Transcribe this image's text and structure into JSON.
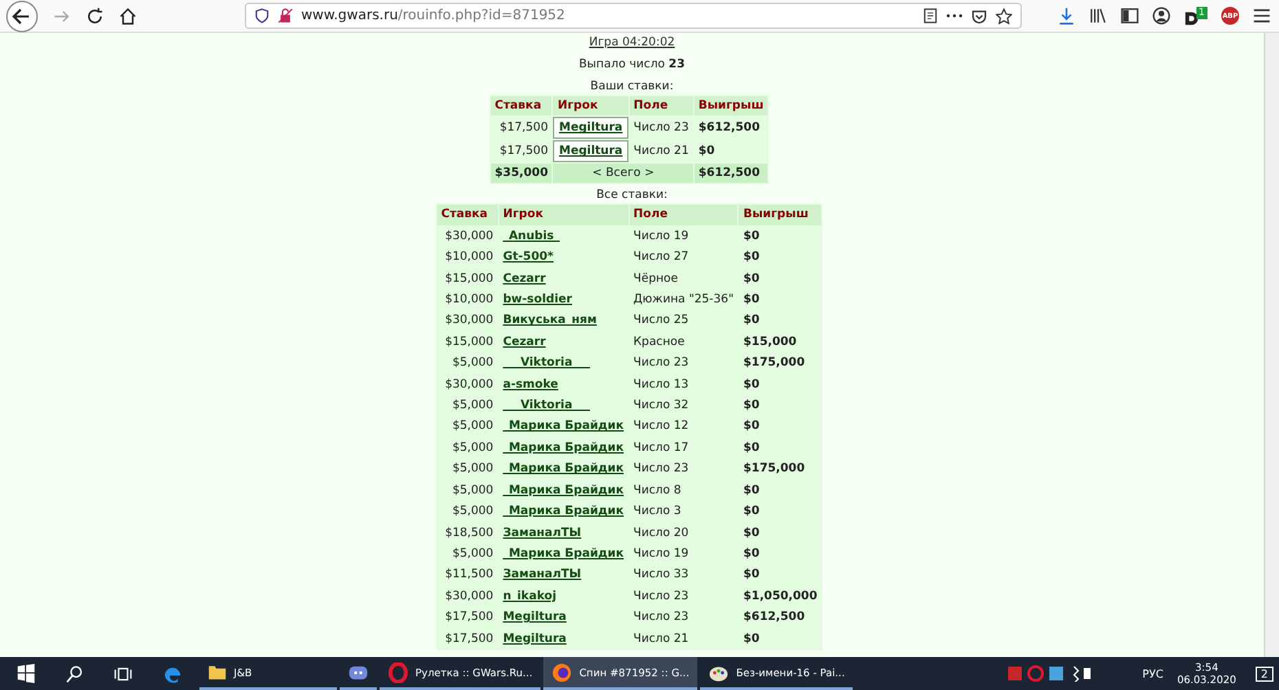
{
  "browser": {
    "url_host": "www.gwars.ru",
    "url_path": "/rouinfo.php?id=871952",
    "extension_badge": "1",
    "adblock_label": "ABP"
  },
  "game": {
    "title": "Игра 04:20:02",
    "result_label": "Выпало число",
    "result_number": "23"
  },
  "your_bets": {
    "caption": "Ваши ставки:",
    "columns": [
      "Ставка",
      "Игрок",
      "Поле",
      "Выигрыш"
    ],
    "rows": [
      {
        "stake": "$17,500",
        "player": "Megiltura",
        "field": "Число 23",
        "win": "$612,500"
      },
      {
        "stake": "$17,500",
        "player": "Megiltura",
        "field": "Число 21",
        "win": "$0"
      }
    ],
    "total": {
      "stake": "$35,000",
      "label": "< Всего >",
      "win": "$612,500"
    }
  },
  "all_bets": {
    "caption": "Все ставки:",
    "columns": [
      "Ставка",
      "Игрок",
      "Поле",
      "Выигрыш"
    ],
    "rows": [
      {
        "stake": "$30,000",
        "player": "_Anubis_",
        "field": "Число 19",
        "win": "$0"
      },
      {
        "stake": "$10,000",
        "player": "Gt-500*",
        "field": "Число 27",
        "win": "$0"
      },
      {
        "stake": "$15,000",
        "player": "Cezarr",
        "field": "Чёрное",
        "win": "$0"
      },
      {
        "stake": "$10,000",
        "player": "bw-soldier",
        "field": "Дюжина \"25-36\"",
        "win": "$0"
      },
      {
        "stake": "$30,000",
        "player": "Викуська_ням",
        "field": "Число 25",
        "win": "$0"
      },
      {
        "stake": "$15,000",
        "player": "Cezarr",
        "field": "Красное",
        "win": "$15,000"
      },
      {
        "stake": "$5,000",
        "player": "___Viktoria___",
        "field": "Число 23",
        "win": "$175,000"
      },
      {
        "stake": "$30,000",
        "player": "a-smoke",
        "field": "Число 13",
        "win": "$0"
      },
      {
        "stake": "$5,000",
        "player": "___Viktoria___",
        "field": "Число 32",
        "win": "$0"
      },
      {
        "stake": "$5,000",
        "player": "_Марика Брайдик",
        "field": "Число 12",
        "win": "$0"
      },
      {
        "stake": "$5,000",
        "player": "_Марика Брайдик",
        "field": "Число 17",
        "win": "$0"
      },
      {
        "stake": "$5,000",
        "player": "_Марика Брайдик",
        "field": "Число 23",
        "win": "$175,000"
      },
      {
        "stake": "$5,000",
        "player": "_Марика Брайдик",
        "field": "Число 8",
        "win": "$0"
      },
      {
        "stake": "$5,000",
        "player": "_Марика Брайдик",
        "field": "Число 3",
        "win": "$0"
      },
      {
        "stake": "$18,500",
        "player": "ЗаманалТЫ",
        "field": "Число 20",
        "win": "$0"
      },
      {
        "stake": "$5,000",
        "player": "_Марика Брайдик",
        "field": "Число 19",
        "win": "$0"
      },
      {
        "stake": "$11,500",
        "player": "ЗаманалТЫ",
        "field": "Число 33",
        "win": "$0"
      },
      {
        "stake": "$30,000",
        "player": "n_ikakoj",
        "field": "Число 23",
        "win": "$1,050,000"
      },
      {
        "stake": "$17,500",
        "player": "Megiltura",
        "field": "Число 23",
        "win": "$612,500"
      },
      {
        "stake": "$17,500",
        "player": "Megiltura",
        "field": "Число 21",
        "win": "$0"
      }
    ]
  },
  "taskbar": {
    "apps": [
      {
        "kind": "folder",
        "label": "J&B",
        "selected": false
      },
      {
        "kind": "discord",
        "selected": false
      },
      {
        "kind": "opera",
        "label": "Рулетка :: GWars.Ru...",
        "selected": false
      },
      {
        "kind": "firefox",
        "label": "Спин #871952 :: G...",
        "selected": true
      },
      {
        "kind": "paint",
        "label": "Без-имени-16 - Pai...",
        "selected": false
      }
    ],
    "language": "РУС",
    "time": "3:54",
    "date": "06.03.2020",
    "notifications": "2"
  }
}
